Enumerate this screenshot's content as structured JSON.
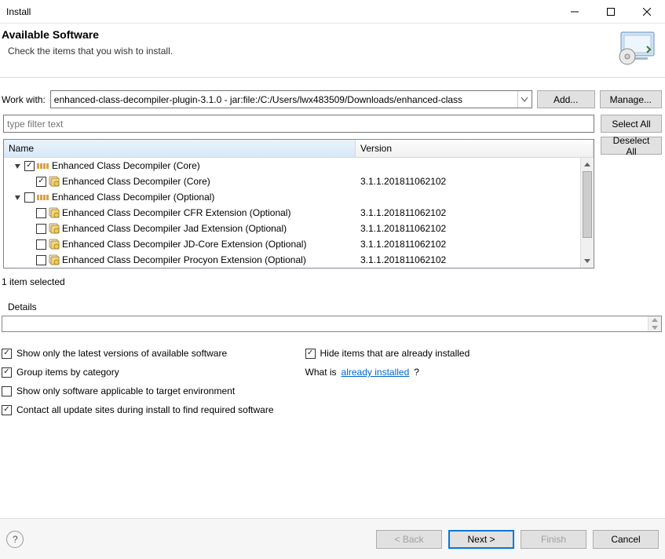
{
  "window": {
    "title": "Install"
  },
  "header": {
    "title": "Available Software",
    "subtitle": "Check the items that you wish to install."
  },
  "workwith": {
    "label": "Work with:",
    "value": "enhanced-class-decompiler-plugin-3.1.0 - jar:file:/C:/Users/lwx483509/Downloads/enhanced-class",
    "add_label": "Add...",
    "manage_label": "Manage..."
  },
  "filter": {
    "placeholder": "type filter text"
  },
  "side_buttons": {
    "select_all": "Select All",
    "deselect_all": "Deselect All"
  },
  "columns": {
    "name": "Name",
    "version": "Version"
  },
  "tree": [
    {
      "type": "category",
      "expanded": true,
      "checked": true,
      "label": "Enhanced Class Decompiler (Core)",
      "children": [
        {
          "type": "feature",
          "checked": true,
          "label": "Enhanced Class Decompiler (Core)",
          "version": "3.1.1.201811062102"
        }
      ]
    },
    {
      "type": "category",
      "expanded": true,
      "checked": false,
      "label": "Enhanced Class Decompiler (Optional)",
      "children": [
        {
          "type": "feature",
          "checked": false,
          "label": "Enhanced Class Decompiler CFR Extension (Optional)",
          "version": "3.1.1.201811062102"
        },
        {
          "type": "feature",
          "checked": false,
          "label": "Enhanced Class Decompiler Jad Extension (Optional)",
          "version": "3.1.1.201811062102"
        },
        {
          "type": "feature",
          "checked": false,
          "label": "Enhanced Class Decompiler JD-Core Extension (Optional)",
          "version": "3.1.1.201811062102"
        },
        {
          "type": "feature",
          "checked": false,
          "label": "Enhanced Class Decompiler Procyon Extension (Optional)",
          "version": "3.1.1.201811062102"
        }
      ]
    }
  ],
  "status": "1 item selected",
  "details": {
    "label": "Details"
  },
  "options": {
    "left": [
      {
        "checked": true,
        "label": "Show only the latest versions of available software"
      },
      {
        "checked": true,
        "label": "Group items by category"
      },
      {
        "checked": false,
        "label": "Show only software applicable to target environment"
      },
      {
        "checked": true,
        "label": "Contact all update sites during install to find required software"
      }
    ],
    "right_check": {
      "checked": true,
      "label": "Hide items that are already installed"
    },
    "right_text_prefix": "What is ",
    "right_link": "already installed",
    "right_text_suffix": "?"
  },
  "footer": {
    "back": "< Back",
    "next": "Next >",
    "finish": "Finish",
    "cancel": "Cancel"
  }
}
